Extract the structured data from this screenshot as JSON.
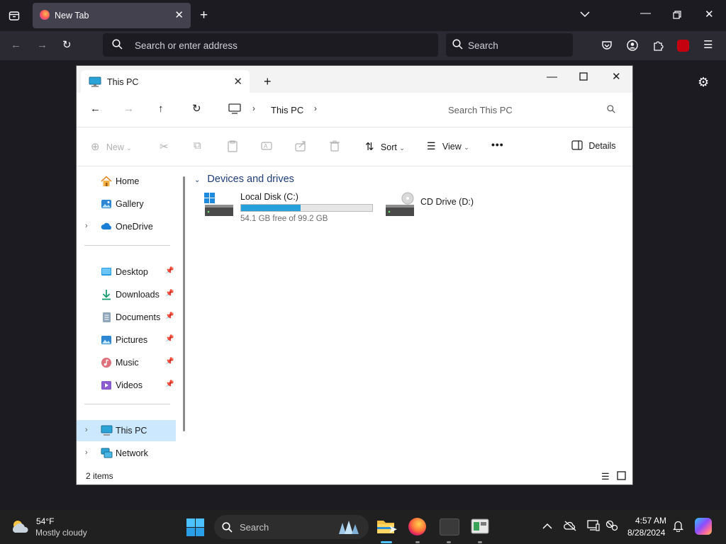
{
  "browser": {
    "tab_title": "New Tab",
    "address_placeholder": "Search or enter address",
    "search_placeholder": "Search"
  },
  "explorer": {
    "tab_title": "This PC",
    "breadcrumb": [
      "This PC"
    ],
    "search_placeholder": "Search This PC",
    "toolbar": {
      "new_label": "New",
      "sort_label": "Sort",
      "view_label": "View",
      "more_label": "•••",
      "details_label": "Details"
    },
    "nav": {
      "top": [
        {
          "label": "Home",
          "icon": "home-icon"
        },
        {
          "label": "Gallery",
          "icon": "gallery-icon"
        },
        {
          "label": "OneDrive",
          "icon": "onedrive-icon"
        }
      ],
      "pinned": [
        {
          "label": "Desktop",
          "icon": "desktop-folder-icon"
        },
        {
          "label": "Downloads",
          "icon": "downloads-icon"
        },
        {
          "label": "Documents",
          "icon": "documents-icon"
        },
        {
          "label": "Pictures",
          "icon": "pictures-icon"
        },
        {
          "label": "Music",
          "icon": "music-icon"
        },
        {
          "label": "Videos",
          "icon": "videos-icon"
        }
      ],
      "bottom": [
        {
          "label": "This PC",
          "icon": "this-pc-icon",
          "selected": true
        },
        {
          "label": "Network",
          "icon": "network-icon"
        }
      ]
    },
    "group_title": "Devices and drives",
    "drives": [
      {
        "name": "Local Disk (C:)",
        "free_text": "54.1 GB free of 99.2 GB",
        "used_fraction": 0.455,
        "icon": "windows-drive-icon"
      },
      {
        "name": "CD Drive (D:)",
        "icon": "cd-drive-icon"
      }
    ],
    "status_text": "2 items",
    "accent_color": "#26a0da"
  },
  "taskbar": {
    "weather_temp": "54°F",
    "weather_desc": "Mostly cloudy",
    "search_placeholder": "Search",
    "time": "4:57 AM",
    "date": "8/28/2024"
  }
}
